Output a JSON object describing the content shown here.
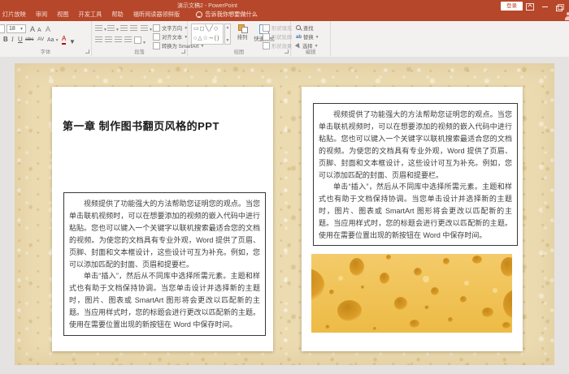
{
  "titlebar": {
    "title": "演示文稿2 - PowerPoint",
    "login": "登录"
  },
  "tabs": {
    "items": [
      "灯片放映",
      "审阅",
      "视图",
      "开发工具",
      "帮助",
      "福昕阅读器领鲜版"
    ],
    "tellme": "告诉我你想要做什么"
  },
  "ribbon": {
    "font": {
      "label": "字体",
      "size": "18",
      "grow": "A",
      "shrink": "A",
      "clear": "A",
      "bold": "B",
      "italic": "I",
      "underline": "U",
      "strike": "abc",
      "spacing": "AV",
      "case": "Aa",
      "color": "A"
    },
    "paragraph": {
      "label": "段落",
      "text_direction": "文字方向",
      "align_text": "对齐文本",
      "smartart": "转换为 SmartArt"
    },
    "drawing": {
      "label": "绘图",
      "shapes_row1": "▭◻╲╱◇",
      "shapes_row2": "○△☆∼()",
      "arrange": "排列",
      "quick_styles": "快速样式",
      "shape_fill": "形状填充",
      "shape_outline": "形状轮廓",
      "shape_effects": "形状效果"
    },
    "editing": {
      "label": "编辑",
      "find": "查找",
      "replace": "替换",
      "select": "选择"
    }
  },
  "slide": {
    "left_page": {
      "title": "第一章 制作图书翻页风格的PPT",
      "para1": "视频提供了功能强大的方法帮助您证明您的观点。当您单击联机视频时，可以在想要添加的视频的嵌入代码中进行粘贴。您也可以键入一个关键字以联机搜索最适合您的文档的视频。为使您的文档具有专业外观，Word 提供了页眉、页脚、封面和文本框设计，这些设计可互为补充。例如，您可以添加匹配的封面、页眉和提要栏。",
      "para2": "单击“插入”，然后从不同库中选择所需元素。主题和样式也有助于文档保持协调。当您单击设计并选择新的主题时，图片、图表或 SmartArt 图形将会更改以匹配新的主题。当应用样式时，您的标题会进行更改以匹配新的主题。使用在需要位置出现的新按钮在 Word 中保存时间。"
    },
    "right_page": {
      "para1": "视频提供了功能强大的方法帮助您证明您的观点。当您单击联机视频时，可以在想要添加的视频的嵌入代码中进行粘贴。您也可以键入一个关键字以联机搜索最适合您的文档的视频。为使您的文档具有专业外观，Word 提供了页眉、页脚、封面和文本框设计，这些设计可互为补充。例如，您可以添加匹配的封面、页眉和提要栏。",
      "para2": "单击“插入”，然后从不同库中选择所需元素。主题和样式也有助于文档保持协调。当您单击设计并选择新的主题时，图片、图表或 SmartArt 图形将会更改以匹配新的主题。当应用样式时，您的标题会进行更改以匹配新的主题。使用在需要位置出现的新按钮在 Word 中保存时间。"
    }
  },
  "colors": {
    "accent": "#b7472a",
    "slide_background": "#ecdbb1",
    "page": "#ffffff",
    "cheese_base": "#f0c35a"
  }
}
